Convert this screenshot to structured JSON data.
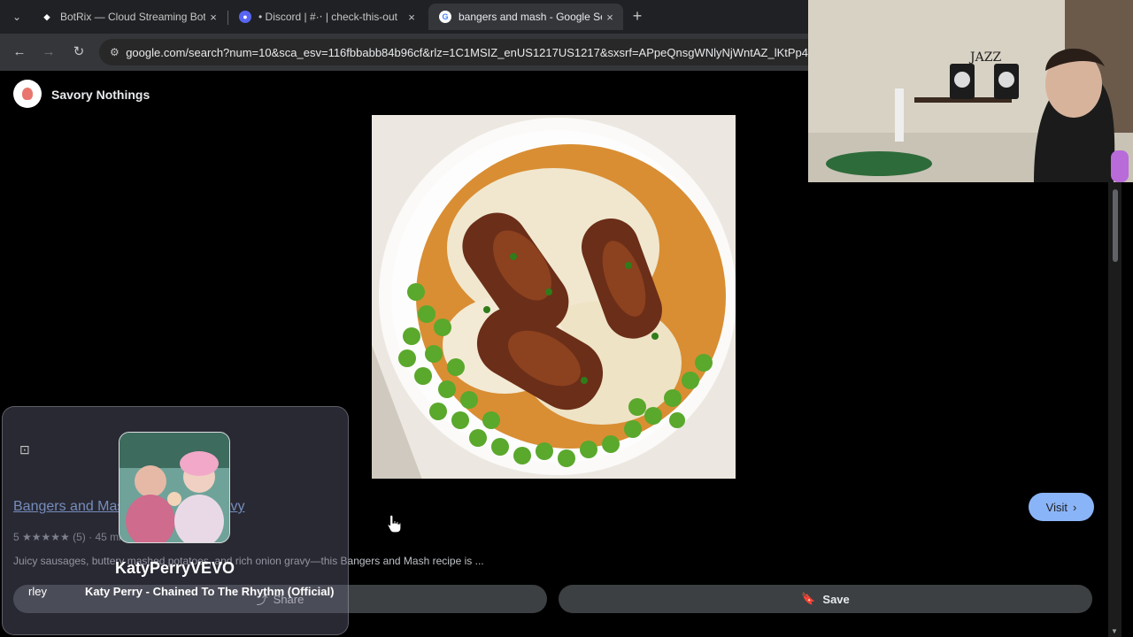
{
  "browser": {
    "tabs": [
      {
        "title": "BotRix — Cloud Streaming Bot",
        "favicon": "botrix-icon",
        "close": "×",
        "active": false
      },
      {
        "title": "• Discord | #·‧ | check-this-out",
        "favicon": "discord-icon",
        "close": "×",
        "active": false
      },
      {
        "title": "bangers and mash - Google Search",
        "favicon": "google-icon",
        "close": "×",
        "active": true
      }
    ],
    "new_tab": "+",
    "url": "google.com/search?num=10&sca_esv=116fbbabb84b96cf&rlz=1C1MSIZ_enUS1217US1217&sxsrf=APpeQnsgWNlyNjWntAZ_lKtPp4"
  },
  "page": {
    "site_name": "Savory Nothings",
    "result": {
      "title": "Bangers and Mash with Onion Gravy",
      "rating": "5 ★★★★★ (5) · 45 min",
      "description": "Juicy sausages, buttery mashed potatoes, and rich onion gravy—this Bangers and Mash recipe is ...",
      "visit_label": "Visit",
      "share_label": "Share",
      "save_label": "Save"
    }
  },
  "alert": {
    "channel": "KatyPerryVEVO",
    "song": "Katy Perry - Chained To The Rhythm (Official)",
    "user": "rley"
  },
  "webcam": {
    "poster_text": "JAZZ"
  },
  "colors": {
    "accent": "#8ab4f8",
    "tab_bg": "#202124",
    "toolbar_bg": "#35363a"
  }
}
